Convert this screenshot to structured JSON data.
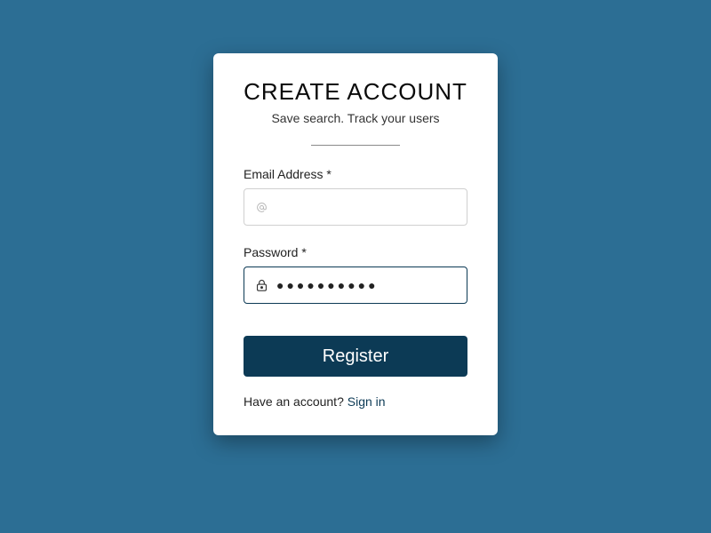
{
  "card": {
    "title": "CREATE ACCOUNT",
    "subtitle": "Save search. Track your users",
    "email": {
      "label": "Email Address *",
      "value": "",
      "placeholder": ""
    },
    "password": {
      "label": "Password *",
      "mask": "●●●●●●●●●●"
    },
    "register_label": "Register",
    "signin_prompt": "Have an account? ",
    "signin_link": "Sign in"
  }
}
